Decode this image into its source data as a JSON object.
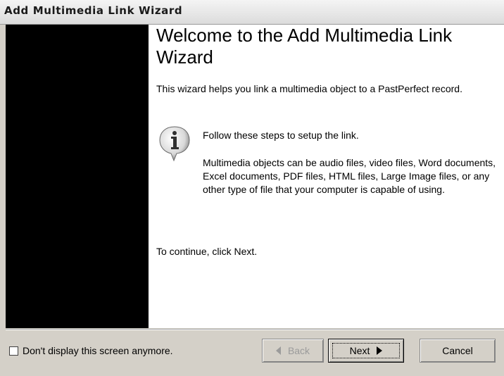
{
  "window": {
    "title": "Add Multimedia Link Wizard"
  },
  "main": {
    "heading": "Welcome to the Add Multimedia Link Wizard",
    "intro": "This wizard helps you link a multimedia object to a PastPerfect record.",
    "steps_text": "Follow these steps to setup the link.",
    "details_text": "Multimedia objects can be audio files, video files, Word documents, Excel documents, PDF files, HTML files, Large Image files, or any other type of file that your computer is capable of using.",
    "continue_text": "To continue, click Next.",
    "info_icon": "information-icon"
  },
  "footer": {
    "checkbox_label": "Don't display this screen anymore.",
    "checkbox_checked": false,
    "back_label": "Back",
    "next_label": "Next",
    "cancel_label": "Cancel"
  },
  "colors": {
    "side_panel": "#000000",
    "dialog_bg": "#d4d0c8",
    "disabled_text": "#9b9b9b"
  }
}
